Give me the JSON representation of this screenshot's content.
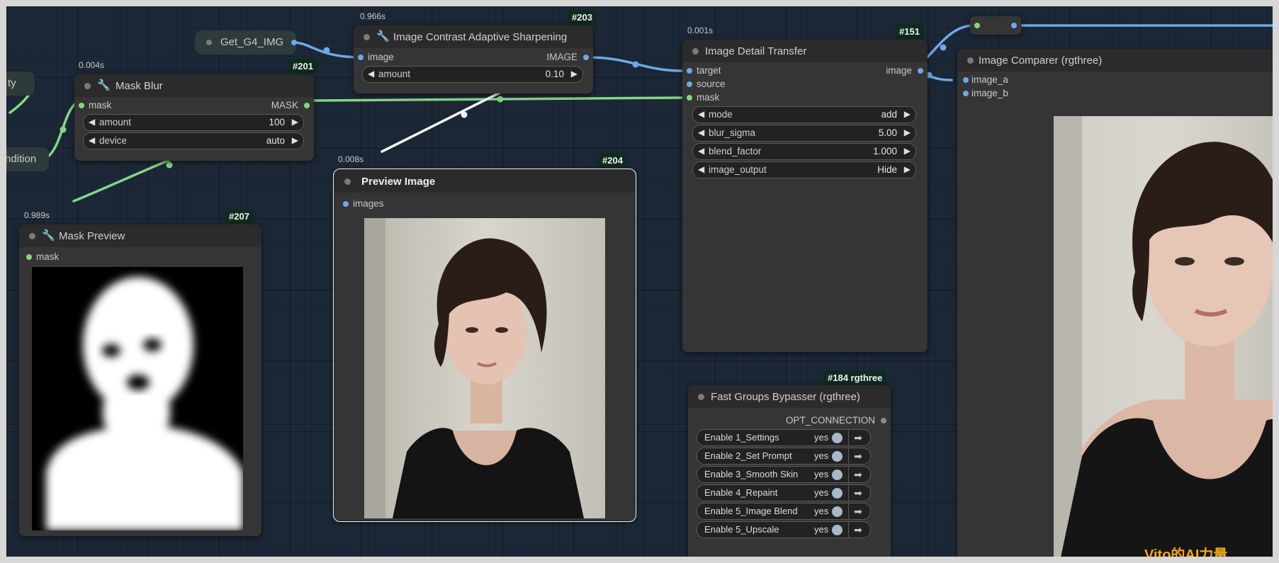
{
  "colors": {
    "image_wire": "#6ea8e8",
    "mask_wire": "#86d586",
    "badge_bg": "#0f2a1f",
    "canvas_bg": "#1c2837"
  },
  "left_edge": {
    "partial_label_1": "ty",
    "partial_label_2": "ndition"
  },
  "getter": {
    "label": "Get_G4_IMG"
  },
  "mask_blur": {
    "timing": "0.004s",
    "id": "#201",
    "title": "Mask Blur",
    "icon": "wrench-icon",
    "input_label": "mask",
    "output_label": "MASK",
    "widgets": [
      {
        "label": "amount",
        "value": "100"
      },
      {
        "label": "device",
        "value": "auto"
      }
    ]
  },
  "sharpen": {
    "timing": "0.966s",
    "id": "#203",
    "title": "Image Contrast Adaptive Sharpening",
    "icon": "wrench-icon",
    "input_label": "image",
    "output_label": "IMAGE",
    "widgets": [
      {
        "label": "amount",
        "value": "0.10"
      }
    ]
  },
  "preview": {
    "timing": "0.008s",
    "id": "#204",
    "title": "Preview Image",
    "input_label": "images"
  },
  "mask_preview": {
    "timing": "0.989s",
    "id": "#207",
    "title": "Mask Preview",
    "icon": "wrench-icon",
    "input_label": "mask"
  },
  "detail": {
    "timing": "0.001s",
    "id": "#151",
    "title": "Image Detail Transfer",
    "inputs": [
      "target",
      "source",
      "mask"
    ],
    "output_label": "image",
    "widgets": [
      {
        "label": "mode",
        "value": "add"
      },
      {
        "label": "blur_sigma",
        "value": "5.00"
      },
      {
        "label": "blend_factor",
        "value": "1.000"
      },
      {
        "label": "image_output",
        "value": "Hide"
      }
    ]
  },
  "bypasser": {
    "id": "#184 rgthree",
    "title": "Fast Groups Bypasser (rgthree)",
    "output_label": "OPT_CONNECTION",
    "rows": [
      {
        "label": "Enable 1_Settings",
        "state": "yes"
      },
      {
        "label": "Enable 2_Set Prompt",
        "state": "yes"
      },
      {
        "label": "Enable 3_Smooth Skin",
        "state": "yes"
      },
      {
        "label": "Enable 4_Repaint",
        "state": "yes"
      },
      {
        "label": "Enable 5_Image Blend",
        "state": "yes"
      },
      {
        "label": "Enable 5_Upscale",
        "state": "yes"
      }
    ]
  },
  "comparer": {
    "title": "Image Comparer (rgthree)",
    "inputs": [
      "image_a",
      "image_b"
    ]
  },
  "watermark": "Vito的AI力量"
}
